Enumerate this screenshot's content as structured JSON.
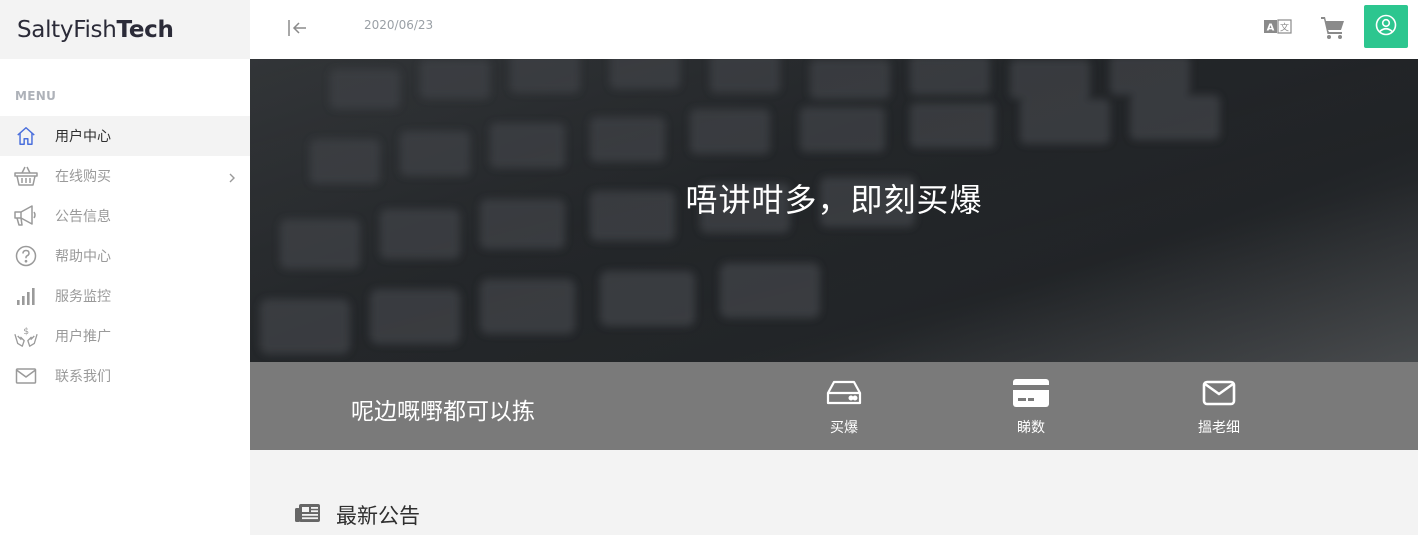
{
  "brand": {
    "name_light": "SaltyFish",
    "name_bold": "Tech"
  },
  "sidebar": {
    "menu_title": "MENU",
    "items": [
      {
        "label": "用户中心",
        "icon": "home-icon",
        "active": true
      },
      {
        "label": "在线购买",
        "icon": "basket-icon",
        "has_submenu": true
      },
      {
        "label": "公告信息",
        "icon": "megaphone-icon"
      },
      {
        "label": "帮助中心",
        "icon": "question-circle-icon"
      },
      {
        "label": "服务监控",
        "icon": "signal-bars-icon"
      },
      {
        "label": "用户推广",
        "icon": "hands-dollar-icon"
      },
      {
        "label": "联系我们",
        "icon": "envelope-icon"
      }
    ]
  },
  "topbar": {
    "date": "2020/06/23",
    "icons": [
      "collapse-sidebar-icon",
      "translate-icon",
      "cart-icon",
      "user-circle-icon"
    ]
  },
  "hero": {
    "title": "唔讲咁多，即刻买爆"
  },
  "actionbar": {
    "text": "呢边嘅嘢都可以拣",
    "items": [
      {
        "label": "买爆",
        "icon": "hard-drive-icon"
      },
      {
        "label": "睇数",
        "icon": "credit-card-icon"
      },
      {
        "label": "搵老细",
        "icon": "envelope-icon"
      }
    ]
  },
  "news": {
    "title": "最新公告",
    "icon": "newspaper-icon"
  },
  "colors": {
    "accent": "#2cc68f",
    "active_menu_icon": "#4a6fdc",
    "actionbar_bg": "#7a7a7a",
    "sidebar_bg": "#ffffff",
    "content_bg": "#f3f3f3"
  }
}
